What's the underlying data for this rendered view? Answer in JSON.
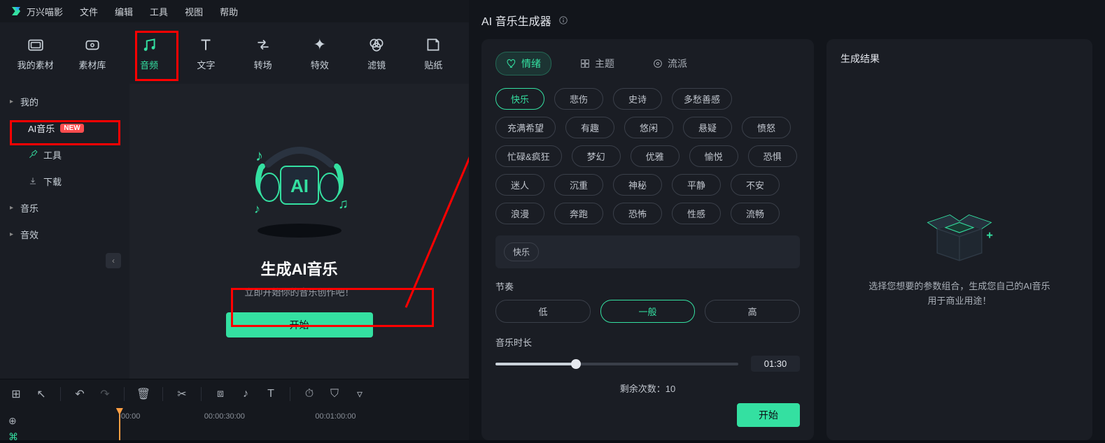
{
  "app": {
    "name": "万兴喵影"
  },
  "menu": [
    "文件",
    "编辑",
    "工具",
    "视图",
    "帮助"
  ],
  "mediaNav": [
    {
      "label": "我的素材",
      "icon": "folder"
    },
    {
      "label": "素材库",
      "icon": "cloud"
    },
    {
      "label": "音频",
      "icon": "music",
      "active": true
    },
    {
      "label": "文字",
      "icon": "text"
    },
    {
      "label": "转场",
      "icon": "swap"
    },
    {
      "label": "特效",
      "icon": "sparkle"
    },
    {
      "label": "滤镜",
      "icon": "circles"
    },
    {
      "label": "贴纸",
      "icon": "sticker"
    }
  ],
  "sidebar": {
    "items": [
      {
        "label": "我的",
        "type": "expand"
      },
      {
        "label": "AI音乐",
        "type": "indent",
        "badge": "NEW",
        "active": true
      },
      {
        "label": "工具",
        "type": "indent",
        "icon": "wrench"
      },
      {
        "label": "下载",
        "type": "indent",
        "icon": "download"
      },
      {
        "label": "音乐",
        "type": "expand"
      },
      {
        "label": "音效",
        "type": "expand"
      }
    ]
  },
  "main": {
    "title": "生成AI音乐",
    "subtitle": "立即开始你的音乐创作吧！",
    "button": "开始"
  },
  "timeline": {
    "ticks": [
      {
        "label": ":00:00",
        "pos": 18
      },
      {
        "label": "00:00:30:00",
        "pos": 38
      },
      {
        "label": "00:01:00:00",
        "pos": 64
      }
    ]
  },
  "dialog": {
    "title": "AI 音乐生成器",
    "tabs": [
      {
        "label": "情绪",
        "icon": "heart",
        "active": true
      },
      {
        "label": "主题",
        "icon": "grid"
      },
      {
        "label": "流派",
        "icon": "disc"
      }
    ],
    "moods": [
      {
        "label": "快乐",
        "active": true
      },
      {
        "label": "悲伤"
      },
      {
        "label": "史诗"
      },
      {
        "label": "多愁善感"
      },
      {
        "label": "充满希望"
      },
      {
        "label": "有趣"
      },
      {
        "label": "悠闲"
      },
      {
        "label": "悬疑"
      },
      {
        "label": "愤怒"
      },
      {
        "label": "忙碌&疯狂"
      },
      {
        "label": "梦幻"
      },
      {
        "label": "优雅"
      },
      {
        "label": "愉悦"
      },
      {
        "label": "恐惧"
      },
      {
        "label": "迷人"
      },
      {
        "label": "沉重"
      },
      {
        "label": "神秘"
      },
      {
        "label": "平静"
      },
      {
        "label": "不安"
      },
      {
        "label": "浪漫"
      },
      {
        "label": "奔跑"
      },
      {
        "label": "恐怖"
      },
      {
        "label": "性感"
      },
      {
        "label": "流畅"
      }
    ],
    "selected": [
      "快乐"
    ],
    "tempo": {
      "label": "节奏",
      "options": [
        {
          "label": "低"
        },
        {
          "label": "一般",
          "active": true
        },
        {
          "label": "高"
        }
      ]
    },
    "duration": {
      "label": "音乐时长",
      "value": "01:30",
      "percent": 33
    },
    "remaining": {
      "label": "剩余次数：",
      "value": "10"
    },
    "startBtn": "开始",
    "results": {
      "title": "生成结果",
      "hint1": "选择您想要的参数组合，生成您自己的AI音乐",
      "hint2": "用于商业用途！"
    }
  }
}
